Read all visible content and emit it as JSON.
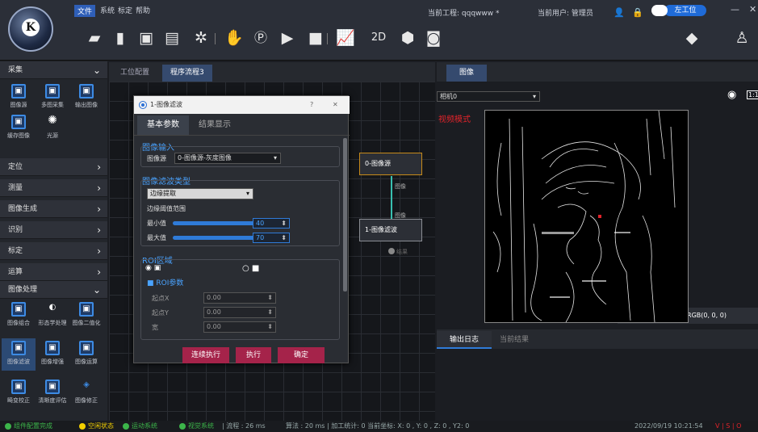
{
  "menu": {
    "file": "文件",
    "system": "系统",
    "calibrate": "标定",
    "help": "帮助"
  },
  "header": {
    "project": "当前工程: qqqwww *",
    "user": "当前用户: 管理员",
    "station": "左工位"
  },
  "sidebar": {
    "cat_capture": "采集",
    "capture_tools": [
      "图像源",
      "多图采集",
      "输出图像",
      "缓存图像",
      "光源"
    ],
    "cats": [
      "定位",
      "测量",
      "图像生成",
      "识别",
      "标定",
      "运算"
    ],
    "cat_imgproc": "图像处理",
    "imgproc_tools": [
      "图像组合",
      "形态学处理",
      "图像二值化",
      "图像滤波",
      "图像增强",
      "图像运算",
      "畸变校正",
      "清晰度评估",
      "图像修正"
    ]
  },
  "tabs": [
    "工位配置",
    "程序流程3"
  ],
  "dialog": {
    "title": "1-图像滤波",
    "question": "?",
    "close": "✕",
    "tabs": [
      "基本参数",
      "结果显示"
    ],
    "sec_input": "图像输入",
    "input_label": "图像源",
    "input_value": "0-图像源-灰度图像",
    "sec_filter": "图像滤波类型",
    "filter_value": "边缘提取",
    "range_label": "边缘阈值范围",
    "min_label": "最小值",
    "min_value": "40",
    "min_level": 0.62,
    "max_label": "最大值",
    "max_value": "70",
    "max_level": 0.66,
    "sec_roi": "ROI区域",
    "roi_params": "ROI参数",
    "roi_fields": [
      {
        "label": "起点X",
        "value": "0.00"
      },
      {
        "label": "起点Y",
        "value": "0.00"
      },
      {
        "label": "宽",
        "value": "0.00"
      }
    ],
    "buttons": [
      "连续执行",
      "执行",
      "确定"
    ]
  },
  "nodes": {
    "n0": "0-图像源",
    "n1": "1-图像滤波",
    "port_out": "图像",
    "port_in": "图像",
    "port_bottom": "结果"
  },
  "image_panel": {
    "tab": "图像",
    "camera": "相机0",
    "mode": "视频模式",
    "coords": "X, Y(52, 394)  | RGB(0, 0, 0)"
  },
  "log_panel": {
    "tabs": [
      "输出日志",
      "当前结果"
    ]
  },
  "status": {
    "s1": "组件配置完成",
    "s2": "空闲状态",
    "s3": "运动系统",
    "s4": "视觉系统",
    "flow": "| 流程 : 26 ms",
    "algo": "算法 : 20 ms | 加工统计: 0   当前坐标: X: 0 , Y: 0 , Z: 0 , Y2: 0",
    "datetime": "2022/09/19 10:21:54",
    "flags": "V | S | O"
  },
  "colors": {
    "accent": "#2f7bd8",
    "status_green": "#3cb54a",
    "status_yellow": "#f4d000",
    "button": "#a5234a",
    "section": "#4aa3ff"
  }
}
